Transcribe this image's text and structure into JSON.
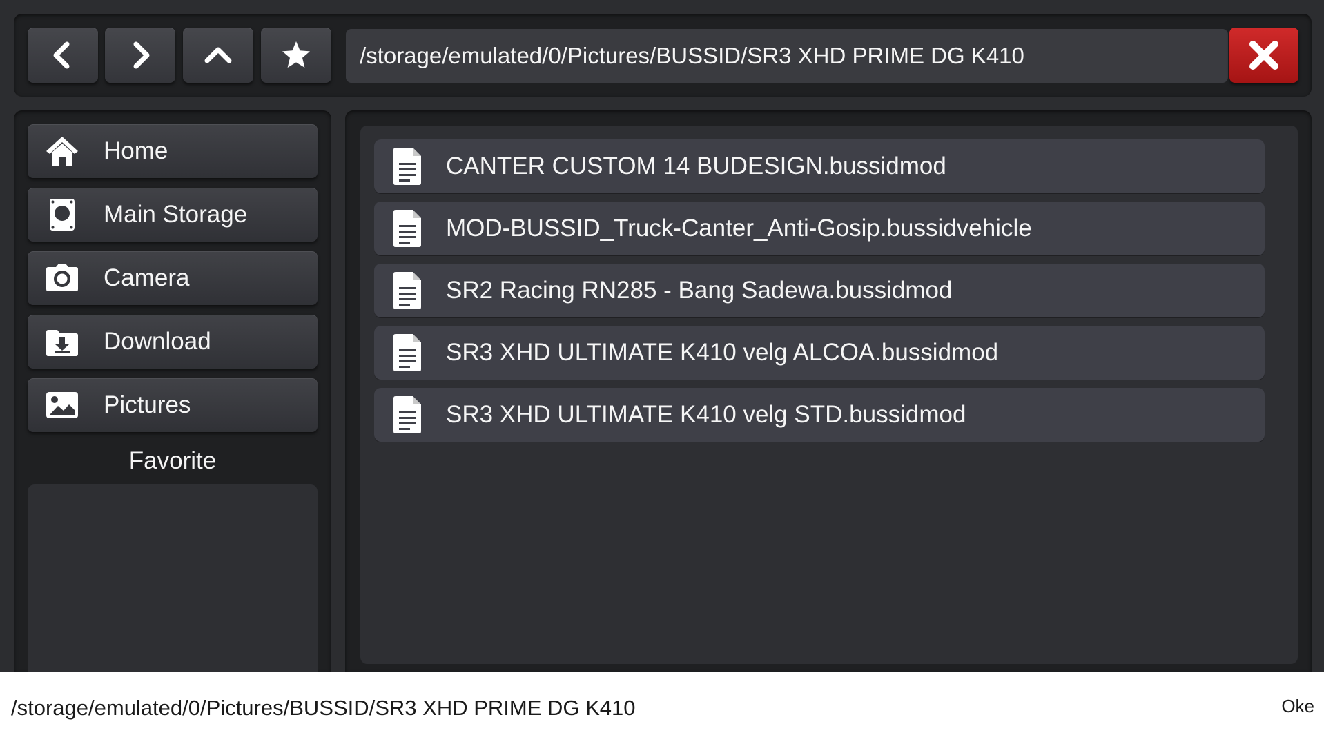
{
  "toolbar": {
    "back_icon": "chevron-left-icon",
    "forward_icon": "chevron-right-icon",
    "up_icon": "chevron-up-icon",
    "favorite_icon": "star-icon",
    "path": "/storage/emulated/0/Pictures/BUSSID/SR3 XHD PRIME DG K410",
    "close_icon": "close-icon",
    "close_color": "#c01d1d"
  },
  "sidebar": {
    "items": [
      {
        "label": "Home",
        "icon": "home-icon"
      },
      {
        "label": "Main Storage",
        "icon": "sd-card-icon"
      },
      {
        "label": "Camera",
        "icon": "camera-icon"
      },
      {
        "label": "Download",
        "icon": "download-icon"
      },
      {
        "label": "Pictures",
        "icon": "image-icon"
      }
    ],
    "favorite_title": "Favorite"
  },
  "files": [
    {
      "name": "CANTER CUSTOM 14 BUDESIGN.bussidmod",
      "icon": "file-icon"
    },
    {
      "name": "MOD-BUSSID_Truck-Canter_Anti-Gosip.bussidvehicle",
      "icon": "file-icon"
    },
    {
      "name": "SR2 Racing RN285 - Bang Sadewa.bussidmod",
      "icon": "file-icon"
    },
    {
      "name": "SR3 XHD ULTIMATE K410 velg ALCOA.bussidmod",
      "icon": "file-icon"
    },
    {
      "name": "SR3 XHD ULTIMATE K410 velg STD.bussidmod",
      "icon": "file-icon"
    }
  ],
  "input_bar": {
    "value": "/storage/emulated/0/Pictures/BUSSID/SR3 XHD PRIME DG K410",
    "ok_label": "Oke"
  }
}
